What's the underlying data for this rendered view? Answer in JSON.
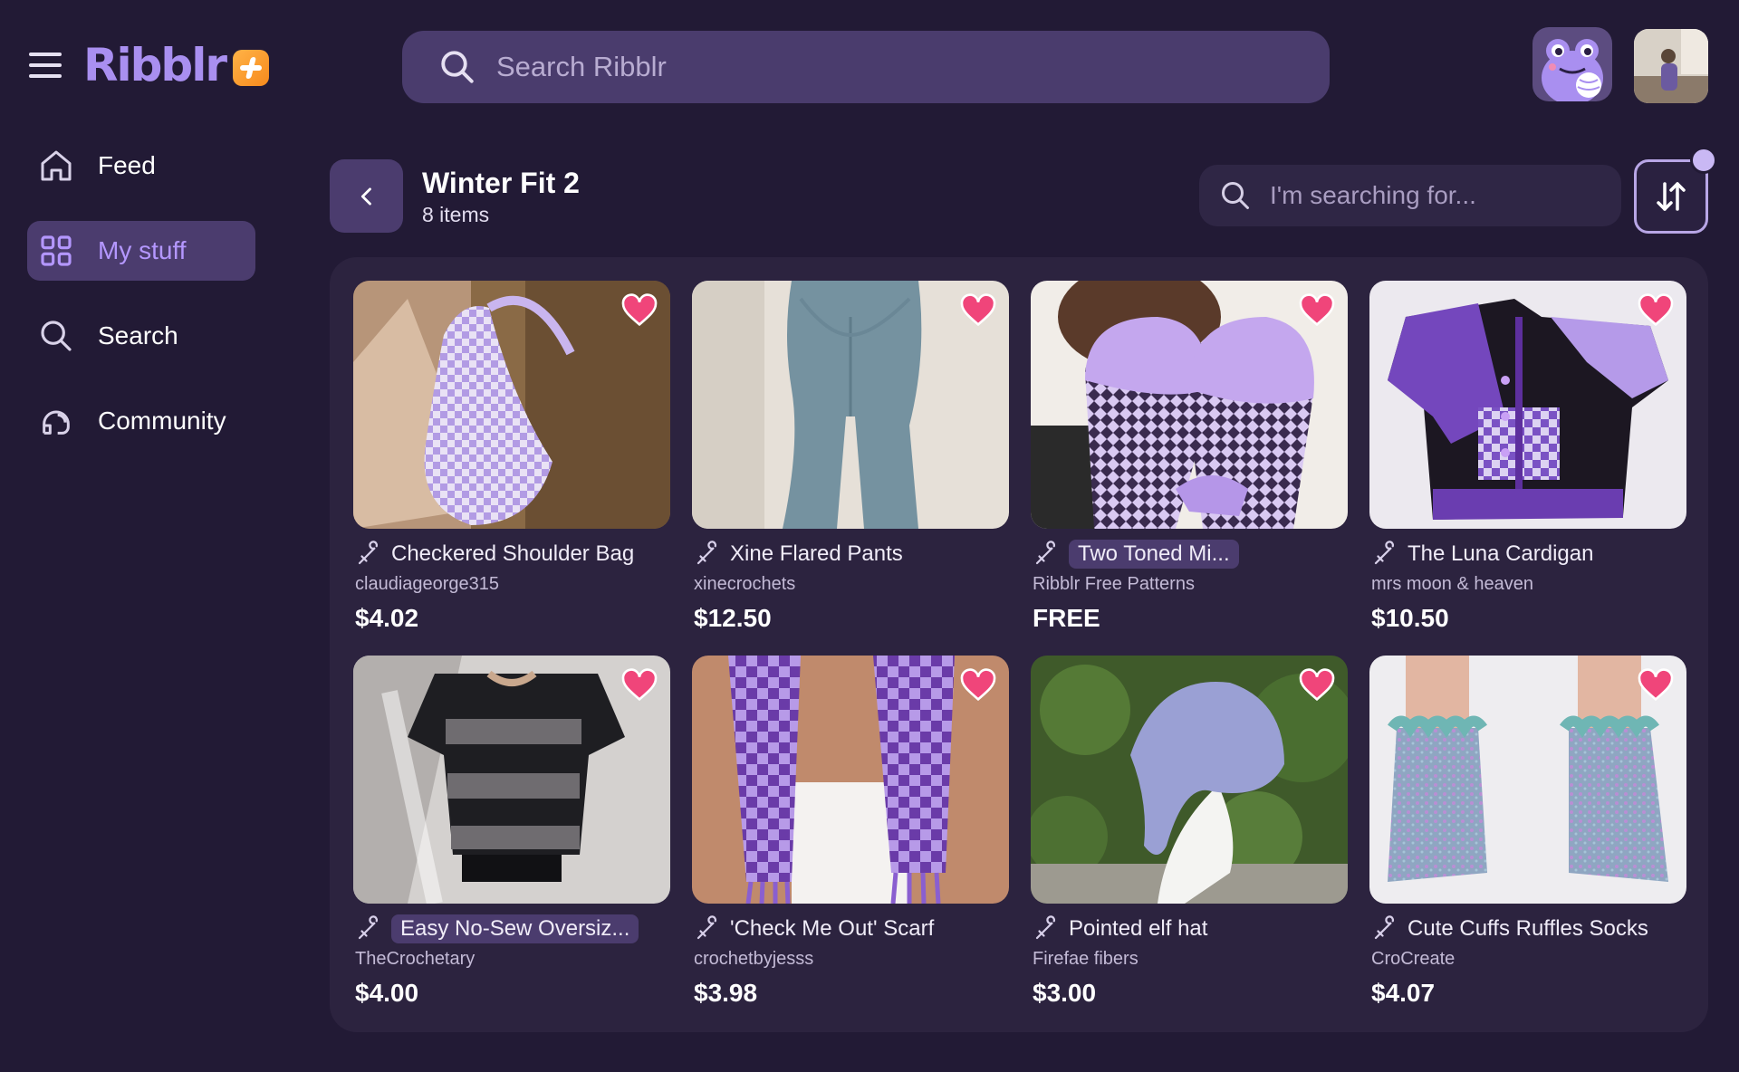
{
  "app": {
    "brand": "Ribblr"
  },
  "top_search": {
    "placeholder": "Search Ribblr"
  },
  "sidebar": {
    "items": [
      {
        "label": "Feed",
        "icon": "home-icon",
        "active": false
      },
      {
        "label": "My stuff",
        "icon": "grid-icon",
        "active": true
      },
      {
        "label": "Search",
        "icon": "search-icon",
        "active": false
      },
      {
        "label": "Community",
        "icon": "community-icon",
        "active": false
      }
    ]
  },
  "collection": {
    "title": "Winter Fit 2",
    "count": "8 items",
    "search_placeholder": "I'm searching for..."
  },
  "items": [
    {
      "title": "Checkered Shoulder Bag",
      "designer": "claudiageorge315",
      "price": "$4.02",
      "highlight": false
    },
    {
      "title": "Xine Flared Pants",
      "designer": "xinecrochets",
      "price": "$12.50",
      "highlight": false
    },
    {
      "title": "Two Toned Mi...",
      "designer": "Ribblr Free Patterns",
      "price": "FREE",
      "highlight": true
    },
    {
      "title": "The Luna Cardigan",
      "designer": "mrs moon & heaven",
      "price": "$10.50",
      "highlight": false
    },
    {
      "title": "Easy No-Sew Oversiz...",
      "designer": "TheCrochetary",
      "price": "$4.00",
      "highlight": true
    },
    {
      "title": "'Check Me Out' Scarf",
      "designer": "crochetbyjesss",
      "price": "$3.98",
      "highlight": false
    },
    {
      "title": "Pointed elf hat",
      "designer": "Firefae fibers",
      "price": "$3.00",
      "highlight": false
    },
    {
      "title": "Cute Cuffs Ruffles Socks",
      "designer": "CroCreate",
      "price": "$4.07",
      "highlight": false
    }
  ],
  "colors": {
    "background": "#221a35",
    "accent": "#a98ff0",
    "heart": "#f0457a",
    "panel": "#2c233f"
  }
}
